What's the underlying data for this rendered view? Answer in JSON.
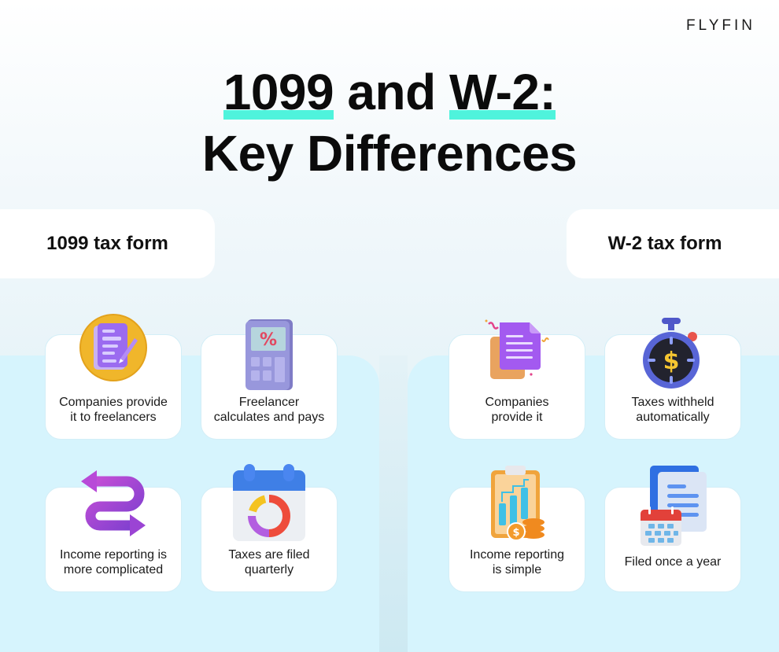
{
  "brand": {
    "logo": "FLYFIN"
  },
  "title": {
    "part1": "1099",
    "part2": " and ",
    "part3": "W-2:",
    "line2": "Key Differences",
    "highlight_color": "#4ff3dc"
  },
  "columns": [
    {
      "heading": "1099 tax form",
      "cards": [
        {
          "icon": "document-pen-icon",
          "label": "Companies provide it to freelancers"
        },
        {
          "icon": "calculator-percent-icon",
          "label": "Freelancer calculates and pays"
        },
        {
          "icon": "winding-arrows-icon",
          "label": "Income reporting is more complicated"
        },
        {
          "icon": "calendar-pie-icon",
          "label": "Taxes are filed quarterly"
        }
      ]
    },
    {
      "heading": "W-2 tax form",
      "cards": [
        {
          "icon": "document-confetti-icon",
          "label": "Companies provide it"
        },
        {
          "icon": "stopwatch-dollar-icon",
          "label": "Taxes withheld automatically"
        },
        {
          "icon": "clipboard-chart-coins-icon",
          "label": "Income reporting is simple"
        },
        {
          "icon": "calendar-documents-icon",
          "label": "Filed once a year"
        }
      ]
    }
  ]
}
